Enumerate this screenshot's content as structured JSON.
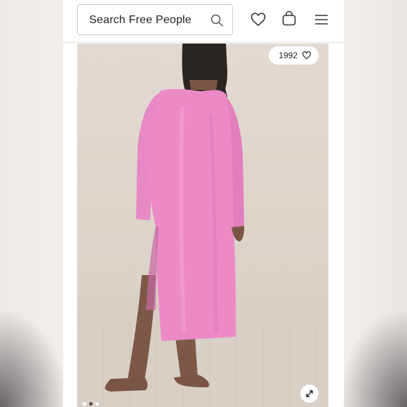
{
  "header": {
    "search_label": "Search Free People",
    "icons": [
      "search-icon",
      "heart-icon",
      "shopping-bag-icon",
      "menu-icon"
    ]
  },
  "product_image": {
    "likes_count": "1992",
    "likes_icon": "heart-icon",
    "expand_icon": "expand-icon",
    "carousel_total": 3,
    "carousel_active": 2
  },
  "colors": {
    "dress": "#ec8ac6",
    "background_wall": "#ddd5cd",
    "text": "#222222"
  }
}
